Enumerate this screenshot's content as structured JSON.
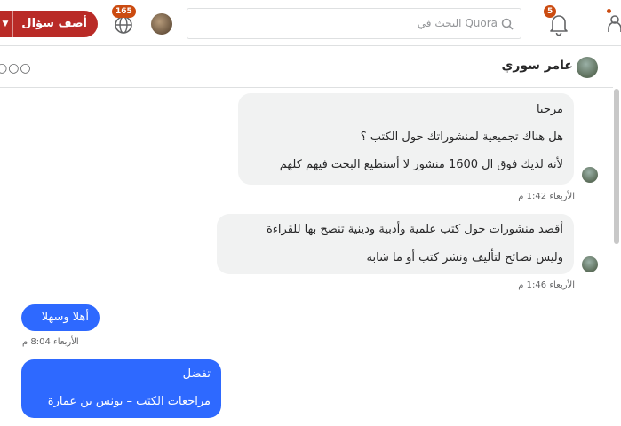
{
  "topbar": {
    "add_question_label": "أضف سؤال",
    "globe_badge": "165",
    "search_placeholder": "البحث في Quora",
    "bell_badge": "5"
  },
  "conversation": {
    "contact_name": "عامر سوري",
    "more_label": "○○○"
  },
  "messages": [
    {
      "lines": [
        "مرحبا",
        "هل هناك تجميعية لمنشوراتك حول الكتب ؟",
        "لأنه لديك فوق ال 1600 منشور لا أستطيع البحث فيهم كلهم"
      ],
      "time": "الأربعاء 1:42 م"
    },
    {
      "lines": [
        "أقصد منشورات حول كتب علمية وأدبية ودينية تنصح بها للقراءة",
        "وليس نصائح لتأليف ونشر كتب أو ما شابه"
      ],
      "time": "الأربعاء 1:46 م"
    },
    {
      "lines": [
        "أهلا وسهلا"
      ],
      "time": "الأربعاء 8:04 م"
    },
    {
      "lines": [
        "تفضل"
      ],
      "link": "مراجعات الكتب – يونس بن عمارة"
    }
  ],
  "colors": {
    "brand": "#b92b27",
    "outgoing": "#2e69ff",
    "incoming": "#f1f2f2",
    "badge": "#cb4b10"
  }
}
